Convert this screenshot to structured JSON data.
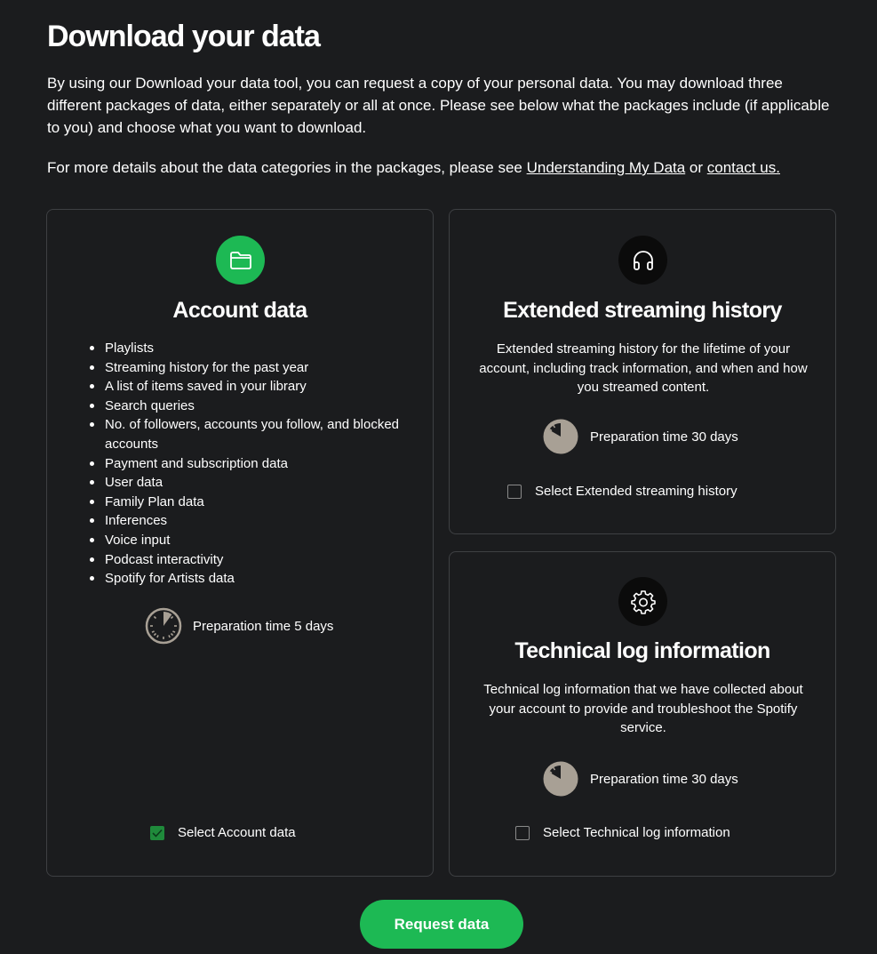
{
  "page": {
    "title": "Download your data",
    "intro": "By using our Download your data tool, you can request a copy of your personal data. You may download three different packages of data, either separately or all at once. Please see below what the packages include (if applicable to you) and choose what you want to download.",
    "details_prefix": "For more details about the data categories in the packages, please see ",
    "details_link1": "Understanding My Data",
    "details_middle": " or ",
    "details_link2": "contact us."
  },
  "account": {
    "icon": "folder-icon",
    "title": "Account data",
    "items": [
      "Playlists",
      "Streaming history for the past year",
      "A list of items saved in your library",
      "Search queries",
      "No. of followers, accounts you follow, and blocked accounts",
      "Payment and subscription data",
      "User data",
      "Family Plan data",
      "Inferences",
      "Voice input",
      "Podcast interactivity",
      "Spotify for Artists data"
    ],
    "prep_time": "Preparation time 5 days",
    "select_label": "Select Account data",
    "selected": true
  },
  "extended": {
    "icon": "headphones-icon",
    "title": "Extended streaming history",
    "description": "Extended streaming history for the lifetime of your account, including track information, and when and how you streamed content.",
    "prep_time": "Preparation time 30 days",
    "select_label": "Select Extended streaming history",
    "selected": false
  },
  "technical": {
    "icon": "gear-icon",
    "title": "Technical log information",
    "description": "Technical log information that we have collected about your account to provide and troubleshoot the Spotify service.",
    "prep_time": "Preparation time 30 days",
    "select_label": "Select Technical log information",
    "selected": false
  },
  "request_button": "Request data",
  "colors": {
    "background": "#1b1c1e",
    "accent": "#1db954",
    "border": "#3e4043",
    "timer_fill": "#a8a095"
  }
}
